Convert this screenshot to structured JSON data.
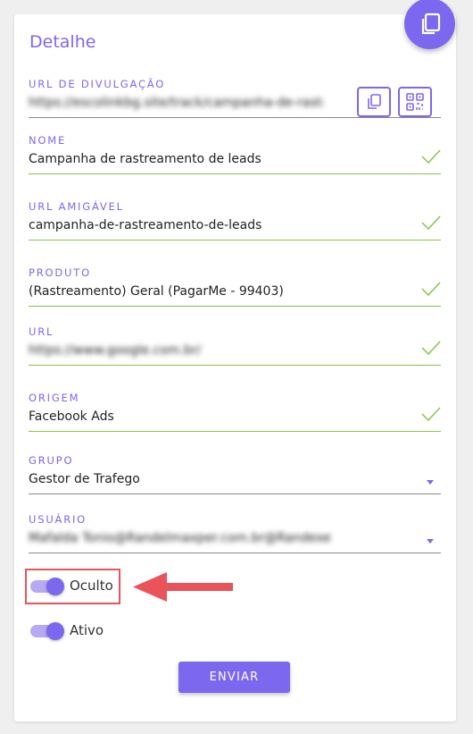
{
  "card": {
    "title": "Detalhe"
  },
  "fields": {
    "url_divulgacao": {
      "label": "URL DE DIVULGAÇÃO",
      "value": "https://escolinkbg.site/track/campanha-de-rastreamento"
    },
    "nome": {
      "label": "NOME",
      "value": "Campanha de rastreamento de leads"
    },
    "url_amigavel": {
      "label": "URL AMIGÁVEL",
      "value": "campanha-de-rastreamento-de-leads"
    },
    "produto": {
      "label": "PRODUTO",
      "value": "(Rastreamento) Geral (PagarMe - 99403)"
    },
    "url": {
      "label": "URL",
      "value": "https://www.google.com.br/"
    },
    "origem": {
      "label": "ORIGEM",
      "value": "Facebook Ads"
    },
    "grupo": {
      "label": "GRUPO",
      "value": "Gestor de Trafego"
    },
    "usuario": {
      "label": "USUÁRIO",
      "value": "Mafalda Tonio@Randelmaxper.com.br@Randexe"
    }
  },
  "toggles": {
    "oculto": {
      "label": "Oculto",
      "on": true
    },
    "ativo": {
      "label": "Ativo",
      "on": true
    }
  },
  "submit_label": "ENVIAR",
  "colors": {
    "accent": "#7b68ee",
    "valid_line": "#8bc34a",
    "annotation": "#e8545a"
  },
  "icons": [
    "copy-icon",
    "qr-code-icon",
    "check-icon",
    "dropdown-caret-icon",
    "annotation-arrow-icon"
  ]
}
